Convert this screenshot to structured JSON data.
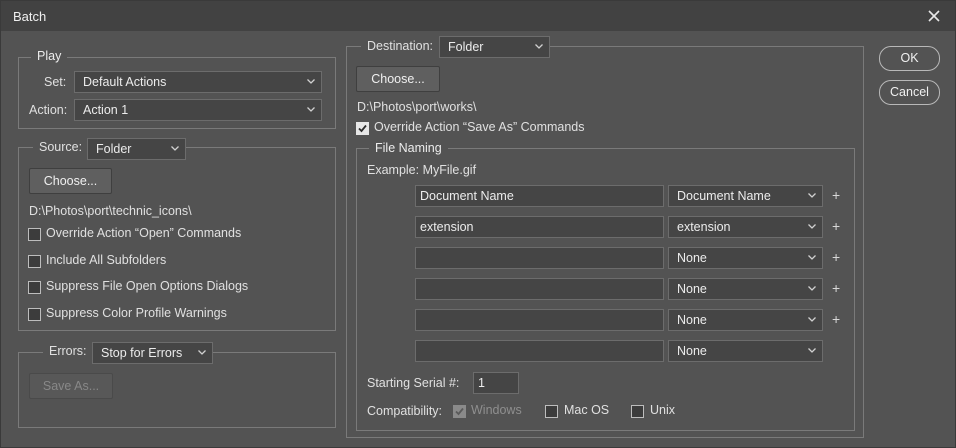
{
  "window": {
    "title": "Batch"
  },
  "play": {
    "legend": "Play",
    "set_label": "Set:",
    "set_value": "Default Actions",
    "action_label": "Action:",
    "action_value": "Action 1"
  },
  "source": {
    "label": "Source:",
    "value": "Folder",
    "choose_label": "Choose...",
    "path": "D:\\Photos\\port\\technic_icons\\",
    "options": [
      {
        "label": "Override Action “Open” Commands",
        "checked": false
      },
      {
        "label": "Include All Subfolders",
        "checked": false
      },
      {
        "label": "Suppress File Open Options Dialogs",
        "checked": false
      },
      {
        "label": "Suppress Color Profile Warnings",
        "checked": false
      }
    ]
  },
  "errors": {
    "label": "Errors:",
    "value": "Stop for Errors",
    "save_as_label": "Save As..."
  },
  "destination": {
    "label": "Destination:",
    "value": "Folder",
    "choose_label": "Choose...",
    "path": "D:\\Photos\\port\\works\\",
    "override_label": "Override Action “Save As” Commands",
    "override_checked": true
  },
  "file_naming": {
    "legend": "File Naming",
    "example": "Example: MyFile.gif",
    "rows": [
      {
        "field": "Document Name",
        "select": "Document Name",
        "plus": "+"
      },
      {
        "field": "extension",
        "select": "extension",
        "plus": "+"
      },
      {
        "field": "",
        "select": "None",
        "plus": "+"
      },
      {
        "field": "",
        "select": "None",
        "plus": "+"
      },
      {
        "field": "",
        "select": "None",
        "plus": "+"
      },
      {
        "field": "",
        "select": "None",
        "plus": ""
      }
    ],
    "serial_label": "Starting Serial #:",
    "serial_value": "1",
    "compat_label": "Compatibility:",
    "compat": [
      {
        "label": "Windows",
        "checked": true,
        "disabled": true
      },
      {
        "label": "Mac OS",
        "checked": false,
        "disabled": false
      },
      {
        "label": "Unix",
        "checked": false,
        "disabled": false
      }
    ]
  },
  "actions": {
    "ok": "OK",
    "cancel": "Cancel"
  },
  "icons": {
    "close": "close-icon",
    "chevron": "chevron-down-icon",
    "check": "checkmark-icon"
  }
}
